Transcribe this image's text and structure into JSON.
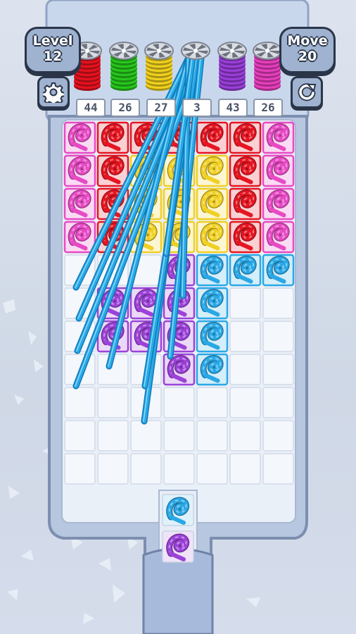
{
  "hud": {
    "level_label": "Level",
    "level_value": "12",
    "move_label": "Move",
    "move_value": "20"
  },
  "icons": {
    "settings": "gear-icon",
    "restart": "restart-icon"
  },
  "spools": [
    {
      "color": "red",
      "hex": "#e8121f",
      "count": "44"
    },
    {
      "color": "green",
      "hex": "#27c81c",
      "count": "26"
    },
    {
      "color": "yellow",
      "hex": "#f2d21e",
      "count": "27"
    },
    {
      "color": "blue",
      "hex": "#27a9e6",
      "count": "3"
    },
    {
      "color": "purple",
      "hex": "#9b3fdc",
      "count": "43"
    },
    {
      "color": "pink",
      "hex": "#e93fbf",
      "count": "26"
    }
  ],
  "active_spool": "blue",
  "colors": {
    "p": "#e74bc4",
    "r": "#e51521",
    "y": "#f0d025",
    "b": "#2aa8e6",
    "v": "#9c42d8"
  },
  "grid": [
    [
      "p",
      "r",
      "r",
      "r",
      "r",
      "r",
      "p"
    ],
    [
      "p",
      "r",
      "y",
      "y",
      "y",
      "r",
      "p"
    ],
    [
      "p",
      "r",
      "y",
      "y",
      "y",
      "r",
      "p"
    ],
    [
      "p",
      "r",
      "y",
      "y",
      "y",
      "r",
      "p"
    ],
    [
      "",
      "",
      "",
      "v",
      "b",
      "b",
      "b"
    ],
    [
      "",
      "v",
      "v",
      "v",
      "b",
      "",
      ""
    ],
    [
      "",
      "v",
      "v",
      "v",
      "b",
      "",
      ""
    ],
    [
      "",
      "",
      "",
      "v",
      "b",
      "",
      ""
    ],
    [
      "",
      "",
      "",
      "",
      "",
      "",
      ""
    ],
    [
      "",
      "",
      "",
      "",
      "",
      "",
      ""
    ],
    [
      "",
      "",
      "",
      "",
      "",
      "",
      ""
    ]
  ],
  "chute": [
    "b",
    "v"
  ]
}
